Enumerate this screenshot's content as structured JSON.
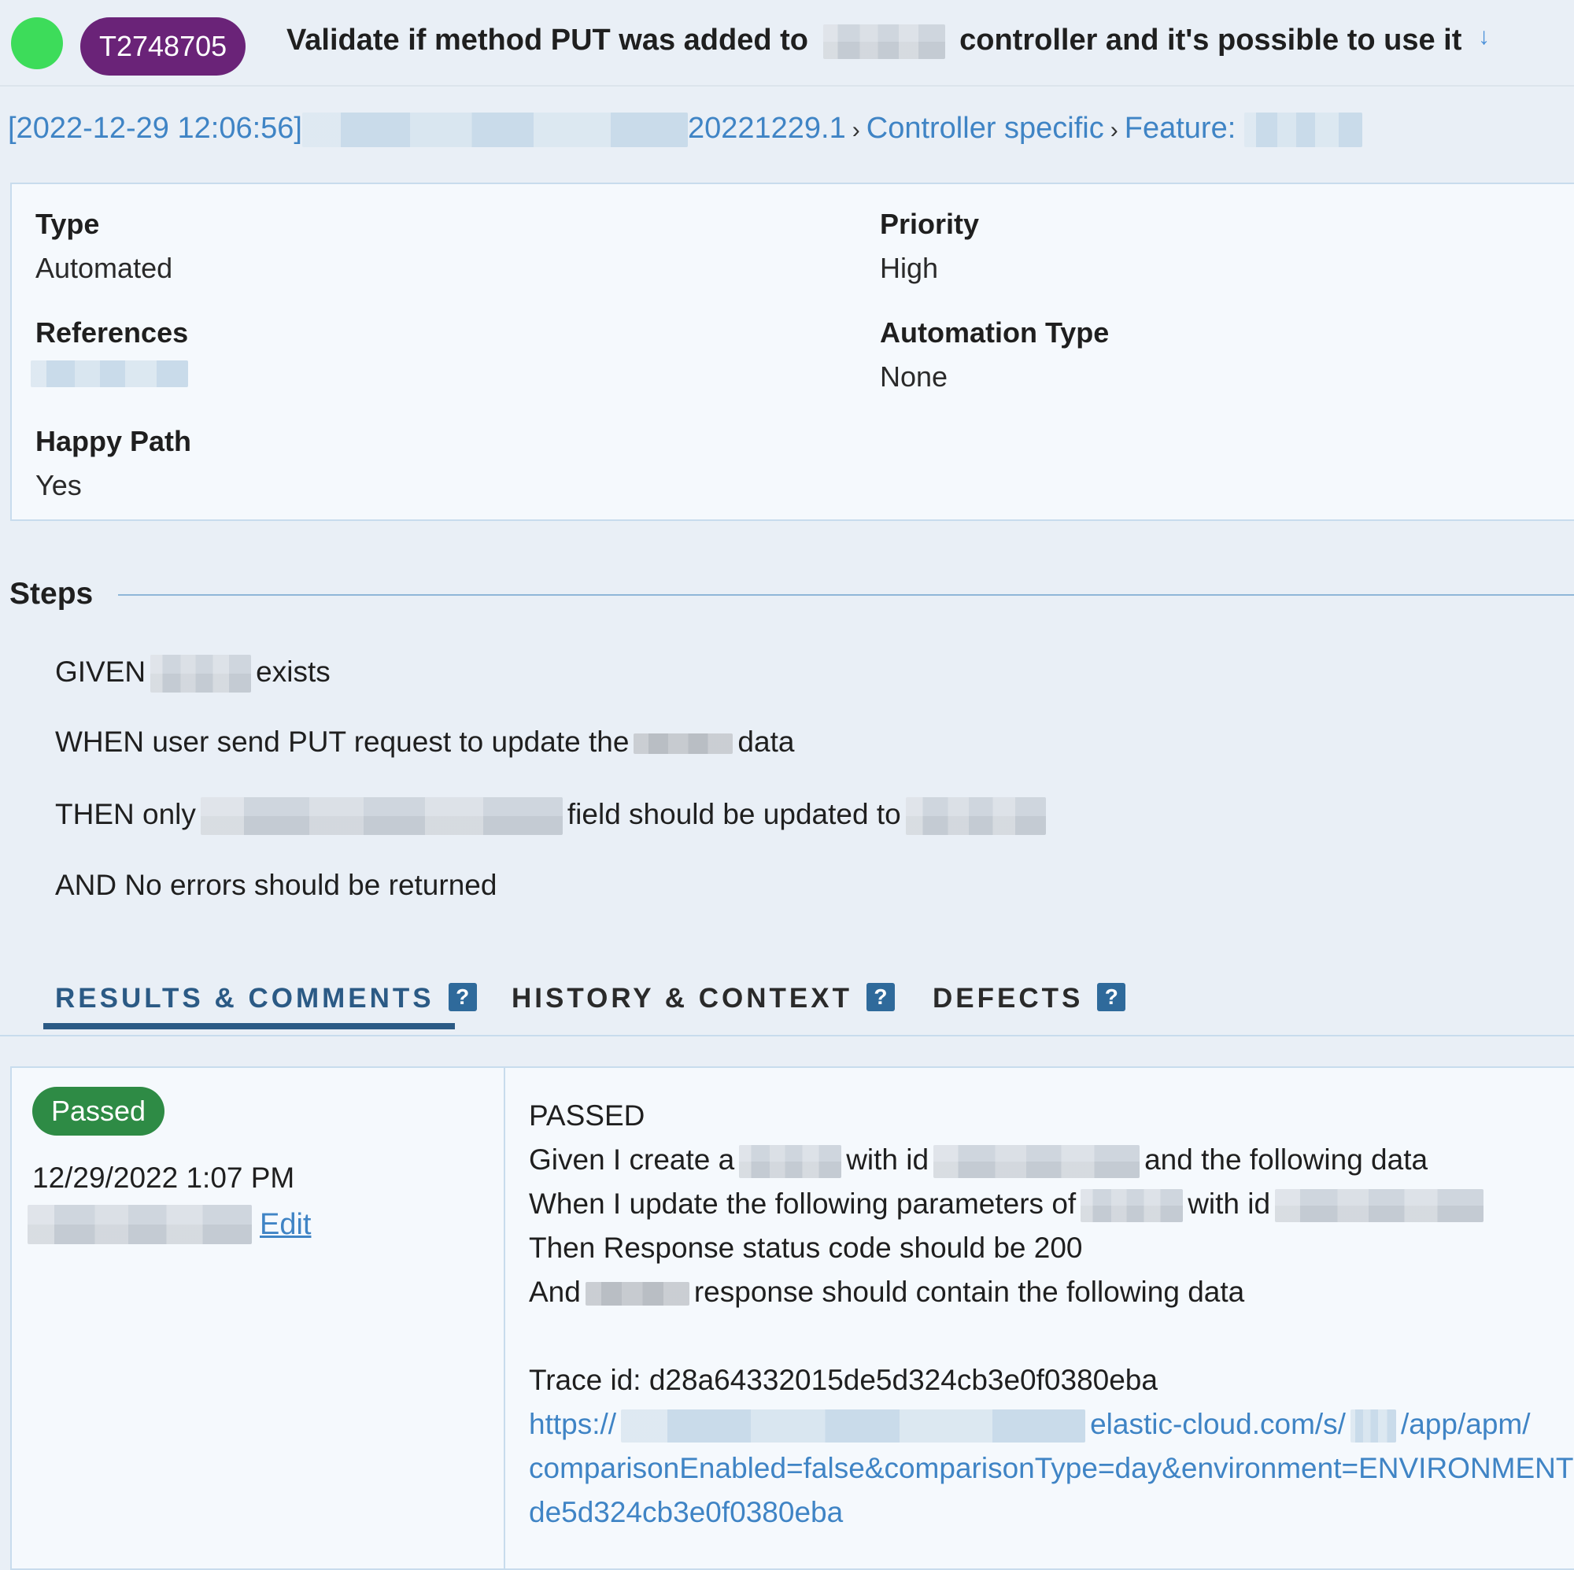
{
  "header": {
    "case_id": "T2748705",
    "title_before": "Validate if method PUT was added to",
    "title_after": "controller and it's possible to use it",
    "arrow": "↓"
  },
  "breadcrumb": {
    "timestamp": "[2022-12-29 12:06:56]",
    "build": "20221229.1",
    "separator": "›",
    "section": "Controller specific",
    "feature": "Feature:"
  },
  "details": {
    "type_label": "Type",
    "type_value": "Automated",
    "priority_label": "Priority",
    "priority_value": "High",
    "references_label": "References",
    "automation_type_label": "Automation Type",
    "automation_type_value": "None",
    "happy_path_label": "Happy Path",
    "happy_path_value": "Yes"
  },
  "steps": {
    "heading": "Steps",
    "given_a": "GIVEN",
    "given_b": "exists",
    "when_a": "WHEN user send PUT request to update the",
    "when_b": "data",
    "then_a": "THEN only",
    "then_b": "field should be updated to",
    "and": "AND No errors should be returned"
  },
  "tabs": {
    "results": "RESULTS & COMMENTS",
    "history": "HISTORY & CONTEXT",
    "defects": "DEFECTS",
    "help": "?"
  },
  "result": {
    "status": "Passed",
    "datetime": "12/29/2022 1:07 PM",
    "edit": "Edit",
    "log_status": "PASSED",
    "l1_a": "Given I create a",
    "l1_b": "with id",
    "l1_c": "and the following data",
    "l2_a": "When I update the following parameters of",
    "l2_b": "with id",
    "l3": "Then Response status code should be 200",
    "l4_a": "And",
    "l4_b": "response should contain the following data",
    "trace": "Trace id: d28a64332015de5d324cb3e0f0380eba",
    "url_a": "https://",
    "url_b": "elastic-cloud.com/s/",
    "url_c": "/app/apm/",
    "url_line2": "comparisonEnabled=false&comparisonType=day&environment=ENVIRONMENT",
    "url_line3": "de5d324cb3e0f0380eba"
  },
  "colors": {
    "status_dot": "#3ddc5a",
    "case_badge": "#6a2378",
    "passed_badge": "#2e8b45",
    "link": "#3f84c5",
    "active_tab": "#2b5a85"
  }
}
